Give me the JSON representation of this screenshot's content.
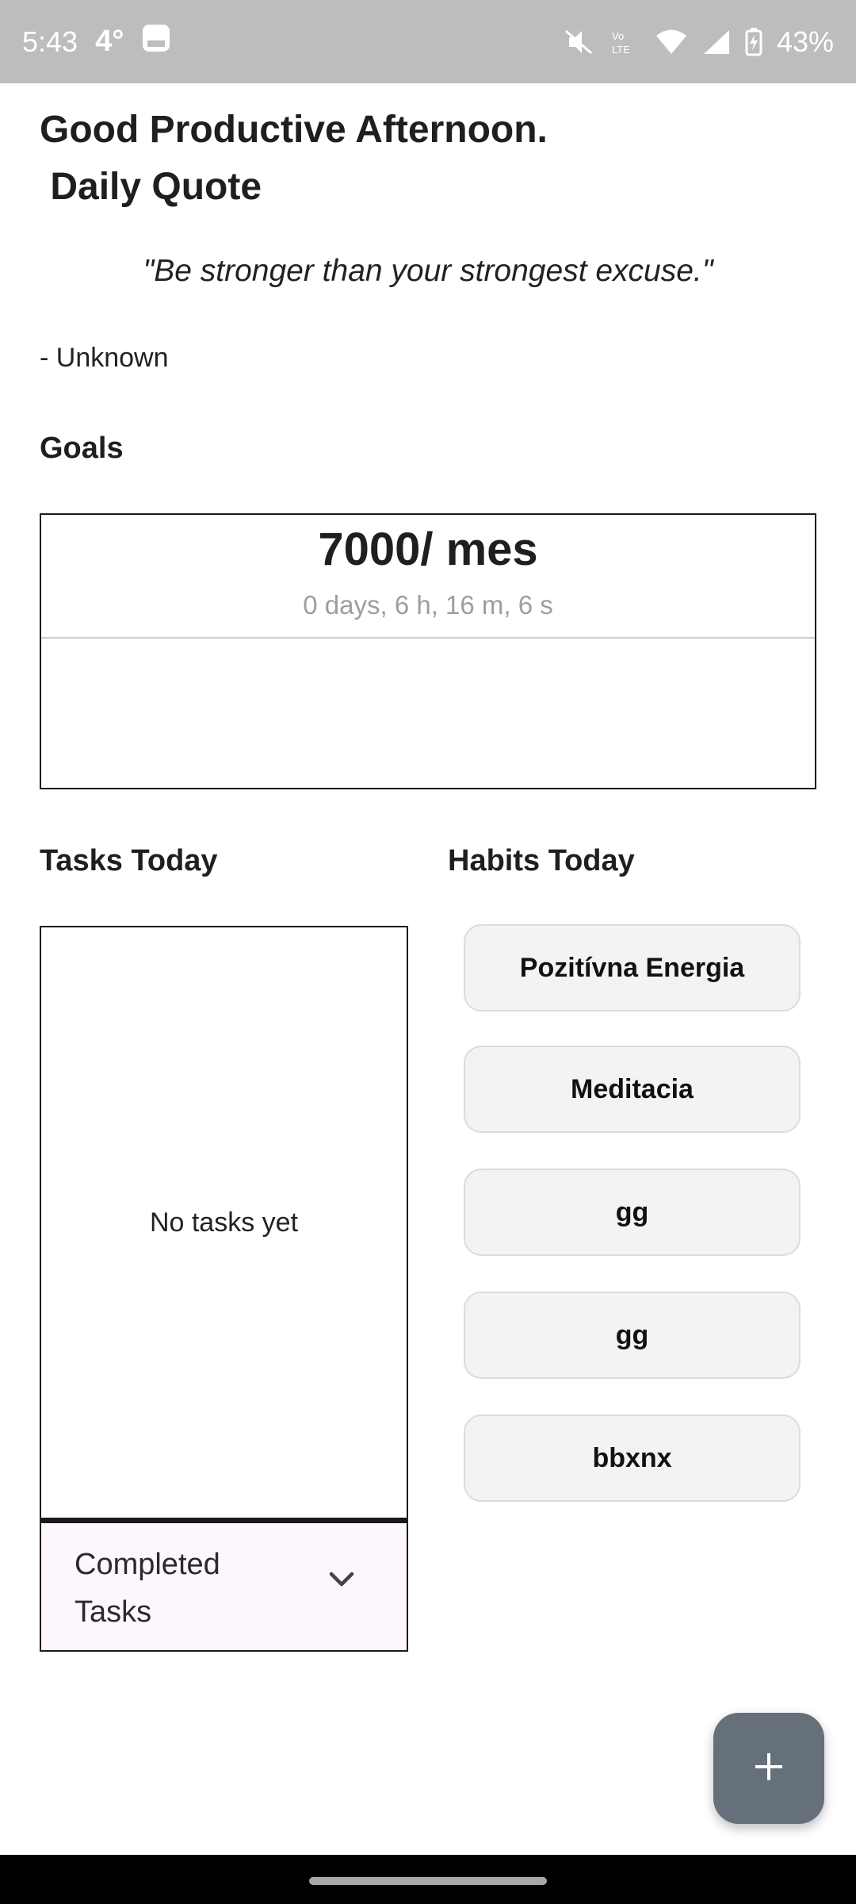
{
  "status_bar": {
    "time": "5:43",
    "temperature": "4°",
    "battery": "43%"
  },
  "greeting": "Good Productive Afternoon.\n Daily Quote",
  "quote": {
    "text": "\"Be stronger than your strongest excuse.\"",
    "author": "- Unknown"
  },
  "goals": {
    "heading": "Goals",
    "items": [
      {
        "title": "7000/ mes",
        "countdown": "0 days, 6 h, 16 m, 6 s"
      }
    ]
  },
  "tasks": {
    "heading": "Tasks Today",
    "empty_text": "No tasks yet",
    "completed_label": "Completed Tasks"
  },
  "habits": {
    "heading": "Habits Today",
    "items": [
      "Pozitívna Energia",
      "Meditacia",
      "gg",
      "gg",
      "bbxnx"
    ]
  },
  "colors": {
    "status_bar": "#bdbdbd",
    "fab": "#65707a",
    "completed_bg": "#fdf6fd",
    "habit_bg": "#f3f3f3"
  },
  "icons": {
    "status": [
      "gallery-icon",
      "mute-icon",
      "volte-icon",
      "wifi-icon",
      "signal-icon",
      "battery-charging-icon"
    ],
    "completed_toggle": "chevron-down-icon",
    "fab": "plus-icon"
  }
}
